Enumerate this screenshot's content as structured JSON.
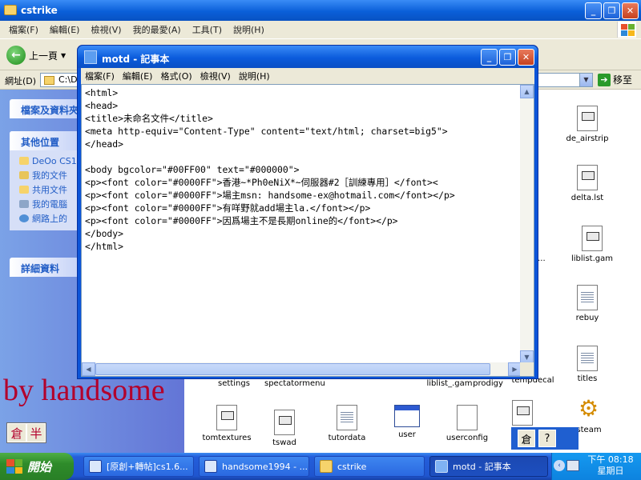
{
  "explorer": {
    "title": "cstrike",
    "menu": [
      "檔案(F)",
      "編輯(E)",
      "檢視(V)",
      "我的最愛(A)",
      "工具(T)",
      "說明(H)"
    ],
    "back_label": "上一頁",
    "address_label": "網址(D)",
    "address_value": "C:\\D",
    "go_label": "移至"
  },
  "task_pane": {
    "section1_title": "檔案及資料夾",
    "section2_title": "其他位置",
    "places": [
      "DeOo CS1",
      "我的文件",
      "共用文件",
      "我的電腦",
      "網路上的"
    ],
    "section3_title": "詳細資料"
  },
  "files": [
    {
      "name": "de_airstrip"
    },
    {
      "name": "delta.lst"
    },
    {
      "name": "liblist.gam"
    },
    {
      "name": "rebuy"
    },
    {
      "name": "titles"
    },
    {
      "name": "steam"
    },
    {
      "name": "settings"
    },
    {
      "name": "spectatormenu"
    },
    {
      "name": "liblist_.gam"
    },
    {
      "name": "prodigy"
    },
    {
      "name": "tempdecal"
    },
    {
      "name": "tomtextures"
    },
    {
      "name": "tswad"
    },
    {
      "name": "tutordata"
    },
    {
      "name": "user"
    },
    {
      "name": "userconfig"
    },
    {
      "name": "dm..."
    }
  ],
  "notepad": {
    "title": "motd - 記事本",
    "menu": [
      "檔案(F)",
      "編輯(E)",
      "格式(O)",
      "檢視(V)",
      "說明(H)"
    ],
    "content": "<html>\n<head>\n<title>未命名文件</title>\n<meta http-equiv=\"Content-Type\" content=\"text/html; charset=big5\">\n</head>\n\n<body bgcolor=\"#00FF00\" text=\"#000000\">\n<p><font color=\"#0000FF\">香港~*Ph0eNiX*~伺服器#2［訓練專用］</font><\n<p><font color=\"#0000FF\">場主msn: handsome-ex@hotmail.com</font></p>\n<p><font color=\"#0000FF\">有咩野就add場主la.</font></p>\n<p><font color=\"#0000FF\">因爲場主不是長期online的</font></p>\n</body>\n</html>"
  },
  "overlay": {
    "handsome_text": "by handsome",
    "ime_left": [
      "倉",
      "半"
    ],
    "ime_right": [
      "倉",
      "?"
    ]
  },
  "taskbar": {
    "start_label": "開始",
    "buttons": [
      "[原創+轉帖]cs1.6...",
      "handsome1994 - ...",
      "cstrike",
      "motd - 記事本"
    ],
    "time": "下午 08:18",
    "day": "星期日"
  }
}
